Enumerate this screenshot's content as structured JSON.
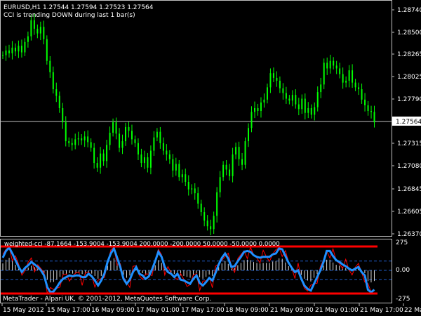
{
  "chart": {
    "symbol_line": "EURUSD,H1  1.27544 1.27594 1.27523 1.27564",
    "status_line": "CCI is trending DOWN during last 1 bar(s)",
    "price_axis": [
      "1.28740",
      "1.28500",
      "1.28265",
      "1.28025",
      "1.27790",
      "1.27564",
      "1.27315",
      "1.27080",
      "1.26845",
      "1.26605",
      "1.26370"
    ],
    "current_price": "1.27564",
    "bull_color": "#00ff00",
    "bear_color": "#00ff00",
    "price_line_color": "#c0c0c0"
  },
  "indicator": {
    "header": "weighted-cci -87.1664 -153.9004 -153.9004 200.0000 -200.0000 50.0000 -50.0000 0.0000",
    "axis": [
      "275",
      "0.00",
      "-275"
    ],
    "upper_level_color": "#ff0000",
    "lower_level_color": "#ff0000",
    "cci_color": "#1e90ff",
    "signal_color": "#ff0000"
  },
  "footer": {
    "copyright": "MetaTrader - Alpari UK, © 2001-2012, MetaQuotes Software Corp."
  },
  "time_axis": [
    "15 May 2012",
    "15 May 17:00",
    "16 May 09:00",
    "17 May 01:00",
    "17 May 17:00",
    "18 May 09:00",
    "21 May 09:00",
    "21 May 01:00",
    "21 May 17:00",
    "22 May 09:00"
  ],
  "series": {
    "closes": [
      1.2826,
      1.2831,
      1.2828,
      1.2834,
      1.283,
      1.2836,
      1.2829,
      1.284,
      1.2846,
      1.2863,
      1.2854,
      1.2849,
      1.2856,
      1.2843,
      1.282,
      1.2808,
      1.279,
      1.2783,
      1.277,
      1.2755,
      1.2735,
      1.2733,
      1.2731,
      1.2737,
      1.2738,
      1.2736,
      1.274,
      1.2734,
      1.2728,
      1.2712,
      1.2707,
      1.2722,
      1.2714,
      1.2731,
      1.2744,
      1.2755,
      1.2743,
      1.2728,
      1.2735,
      1.275,
      1.2746,
      1.2737,
      1.2733,
      1.2721,
      1.2712,
      1.2718,
      1.2707,
      1.2725,
      1.2739,
      1.2745,
      1.2733,
      1.2725,
      1.2721,
      1.2716,
      1.2704,
      1.2711,
      1.2697,
      1.27,
      1.2692,
      1.2684,
      1.2685,
      1.268,
      1.2669,
      1.266,
      1.2651,
      1.2645,
      1.2642,
      1.2656,
      1.2681,
      1.2697,
      1.271,
      1.2705,
      1.2698,
      1.2721,
      1.2729,
      1.2716,
      1.271,
      1.2735,
      1.2749,
      1.2766,
      1.277,
      1.2767,
      1.2776,
      1.2779,
      1.2792,
      1.2807,
      1.2802,
      1.2799,
      1.2791,
      1.2786,
      1.278,
      1.2778,
      1.2784,
      1.2774,
      1.2769,
      1.278,
      1.2765,
      1.277,
      1.2763,
      1.2771,
      1.2787,
      1.2795,
      1.2818,
      1.2812,
      1.282,
      1.2815,
      1.2812,
      1.2806,
      1.2797,
      1.2799,
      1.281,
      1.2797,
      1.2792,
      1.279,
      1.2779,
      1.2773,
      1.2767,
      1.2766,
      1.2755
    ],
    "cci": [
      150,
      230,
      270,
      200,
      120,
      40,
      -20,
      30,
      60,
      100,
      70,
      40,
      0,
      -60,
      -200,
      -260,
      -250,
      -200,
      -140,
      -100,
      -80,
      -60,
      -70,
      -60,
      -60,
      -80,
      -80,
      -40,
      -70,
      -120,
      -180,
      -120,
      -40,
      100,
      200,
      260,
      150,
      40,
      -100,
      -160,
      -110,
      -20,
      40,
      -40,
      -60,
      -100,
      -70,
      10,
      110,
      220,
      160,
      40,
      -20,
      -40,
      -80,
      -40,
      -110,
      -120,
      -140,
      -160,
      -100,
      -60,
      -150,
      -180,
      -140,
      -90,
      -120,
      -30,
      70,
      150,
      200,
      140,
      40,
      50,
      110,
      160,
      220,
      230,
      220,
      180,
      160,
      150,
      160,
      160,
      160,
      190,
      200,
      260,
      250,
      170,
      90,
      30,
      -20,
      0,
      -100,
      -180,
      -220,
      -240,
      -160,
      -80,
      0,
      100,
      230,
      230,
      170,
      120,
      100,
      70,
      50,
      20,
      0,
      20,
      40,
      -20,
      -60,
      -230,
      -260,
      -230
    ]
  }
}
